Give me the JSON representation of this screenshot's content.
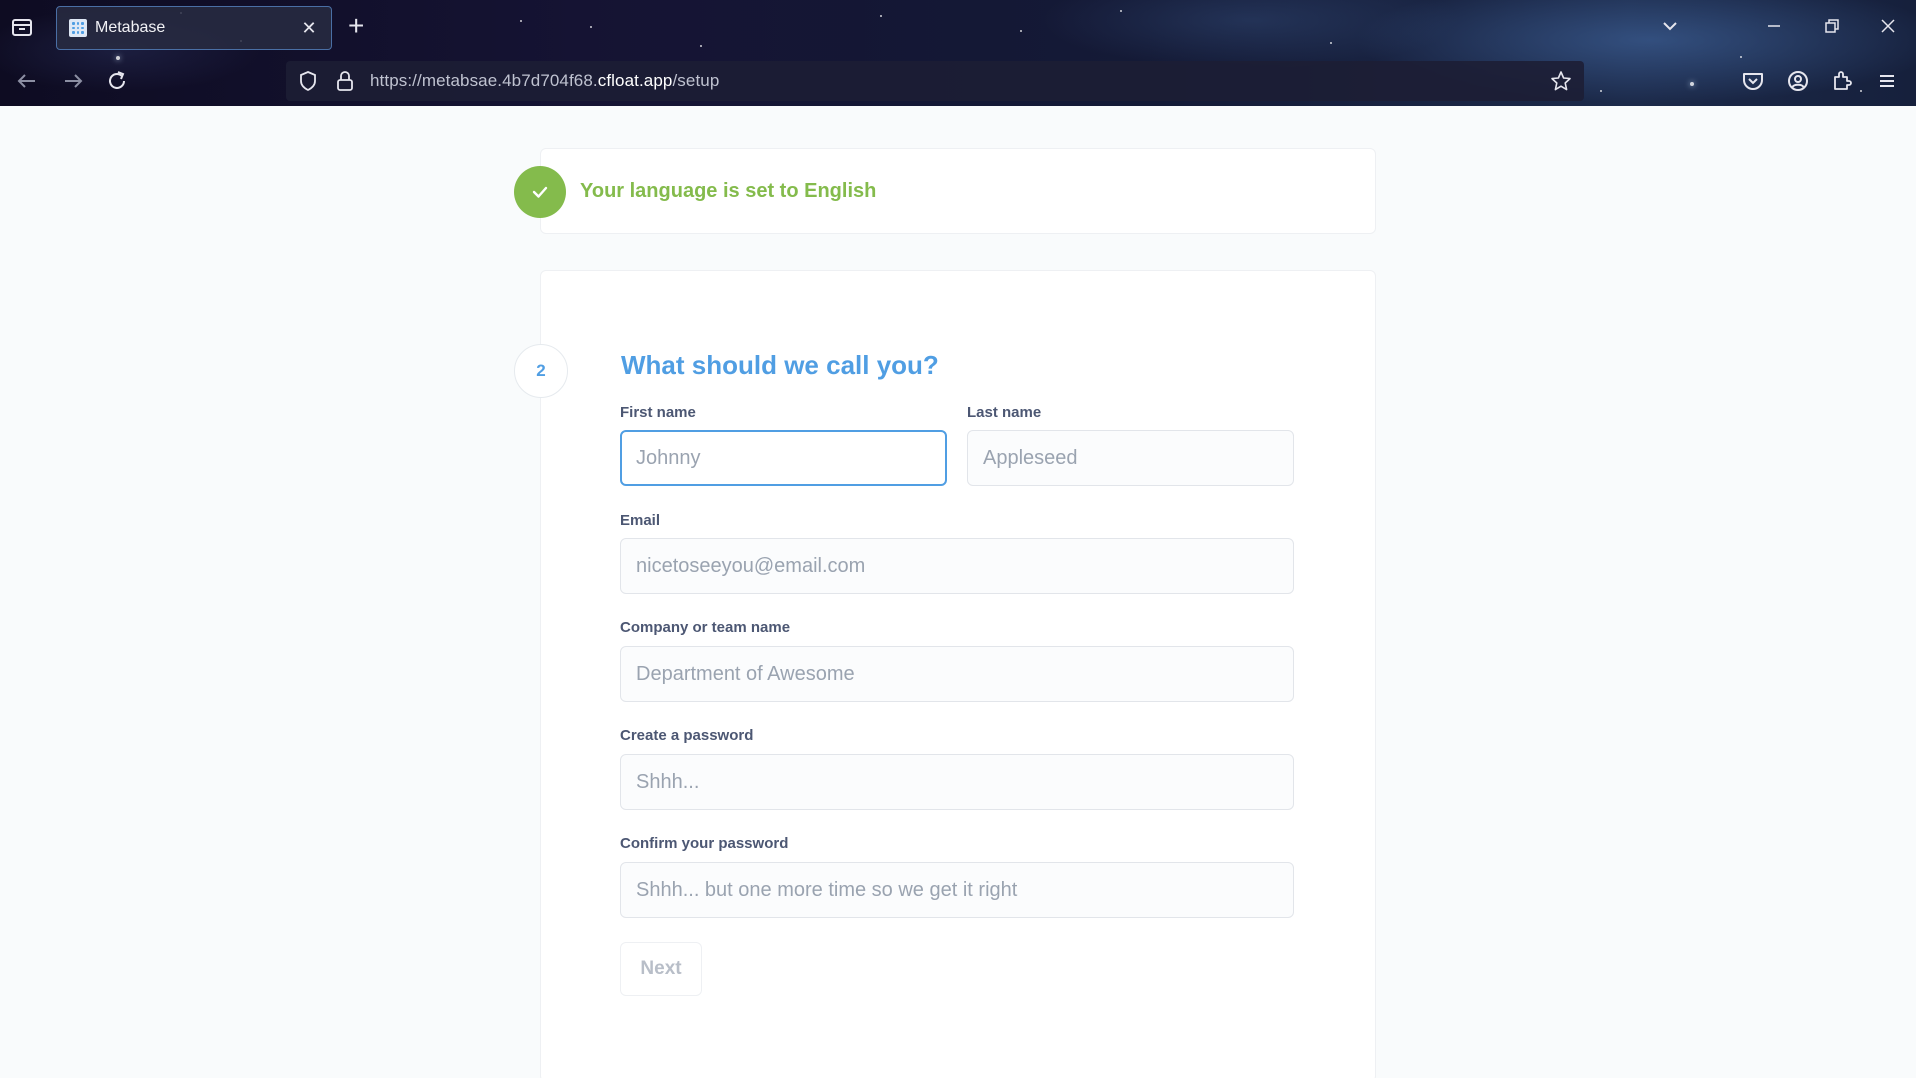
{
  "browser": {
    "tab_title": "Metabase",
    "url_prefix": "https://metabsae.4b7d704f68.",
    "url_domain": "cfloat.app",
    "url_path": "/setup"
  },
  "language_step": {
    "text": "Your language is set to English",
    "status_icon": "check-icon",
    "accent_color": "#84bb4c"
  },
  "user_step": {
    "number": "2",
    "title": "What should we call you?",
    "accent_color": "#509ee3",
    "fields": {
      "first_name": {
        "label": "First name",
        "placeholder": "Johnny",
        "value": ""
      },
      "last_name": {
        "label": "Last name",
        "placeholder": "Appleseed",
        "value": ""
      },
      "email": {
        "label": "Email",
        "placeholder": "nicetoseeyou@email.com",
        "value": ""
      },
      "company": {
        "label": "Company or team name",
        "placeholder": "Department of Awesome",
        "value": ""
      },
      "password": {
        "label": "Create a password",
        "placeholder": "Shhh...",
        "value": ""
      },
      "password_confirm": {
        "label": "Confirm your password",
        "placeholder": "Shhh... but one more time so we get it right",
        "value": ""
      }
    },
    "next_label": "Next"
  }
}
